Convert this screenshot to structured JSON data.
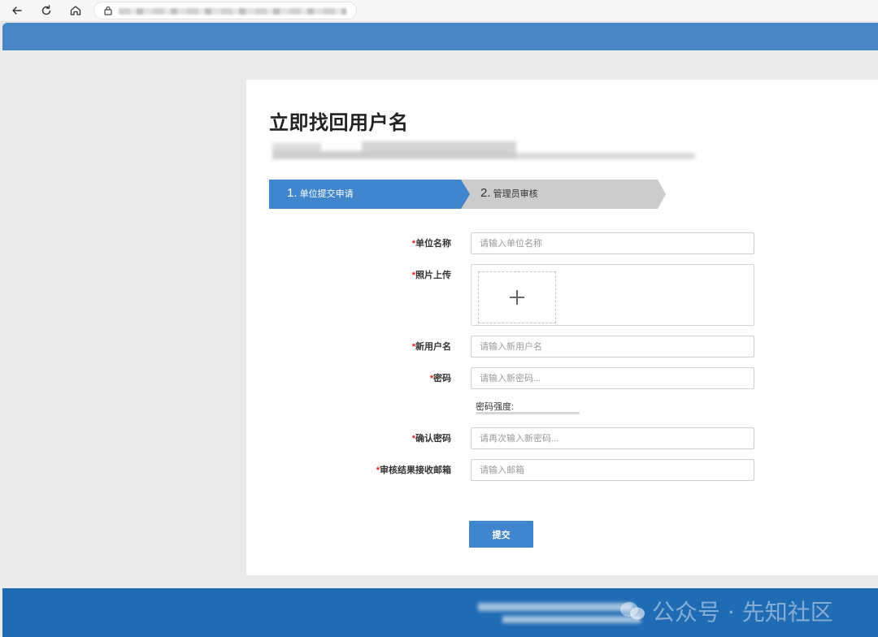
{
  "browser": {
    "icons": [
      "back-arrow-icon",
      "reload-icon",
      "home-icon",
      "lock-icon"
    ]
  },
  "page": {
    "title": "立即找回用户名"
  },
  "steps": [
    {
      "num": "1.",
      "label": "单位提交申请",
      "active": true
    },
    {
      "num": "2.",
      "label": "管理员审核",
      "active": false
    }
  ],
  "form": {
    "required_mark": "*",
    "org_name": {
      "label": "单位名称",
      "placeholder": "请输入单位名称"
    },
    "photo_upload": {
      "label": "照片上传",
      "icon": "plus-icon"
    },
    "new_username": {
      "label": "新用户名",
      "placeholder": "请输入新用户名"
    },
    "password": {
      "label": "密码",
      "placeholder": "请输入新密码..."
    },
    "strength_label": "密码强度:",
    "confirm_password": {
      "label": "确认密码",
      "placeholder": "请再次输入新密码..."
    },
    "email": {
      "label": "审核结果接收邮箱",
      "placeholder": "请输入邮箱"
    },
    "submit_label": "提交"
  },
  "footer": {
    "watermark": "公众号 · 先知社区",
    "watermark_icon": "wechat-icon"
  },
  "colors": {
    "accent": "#3f86cc",
    "header": "#4a87c7",
    "footer": "#1f6bb4",
    "step_inactive": "#cccccc",
    "required": "#e02020"
  }
}
